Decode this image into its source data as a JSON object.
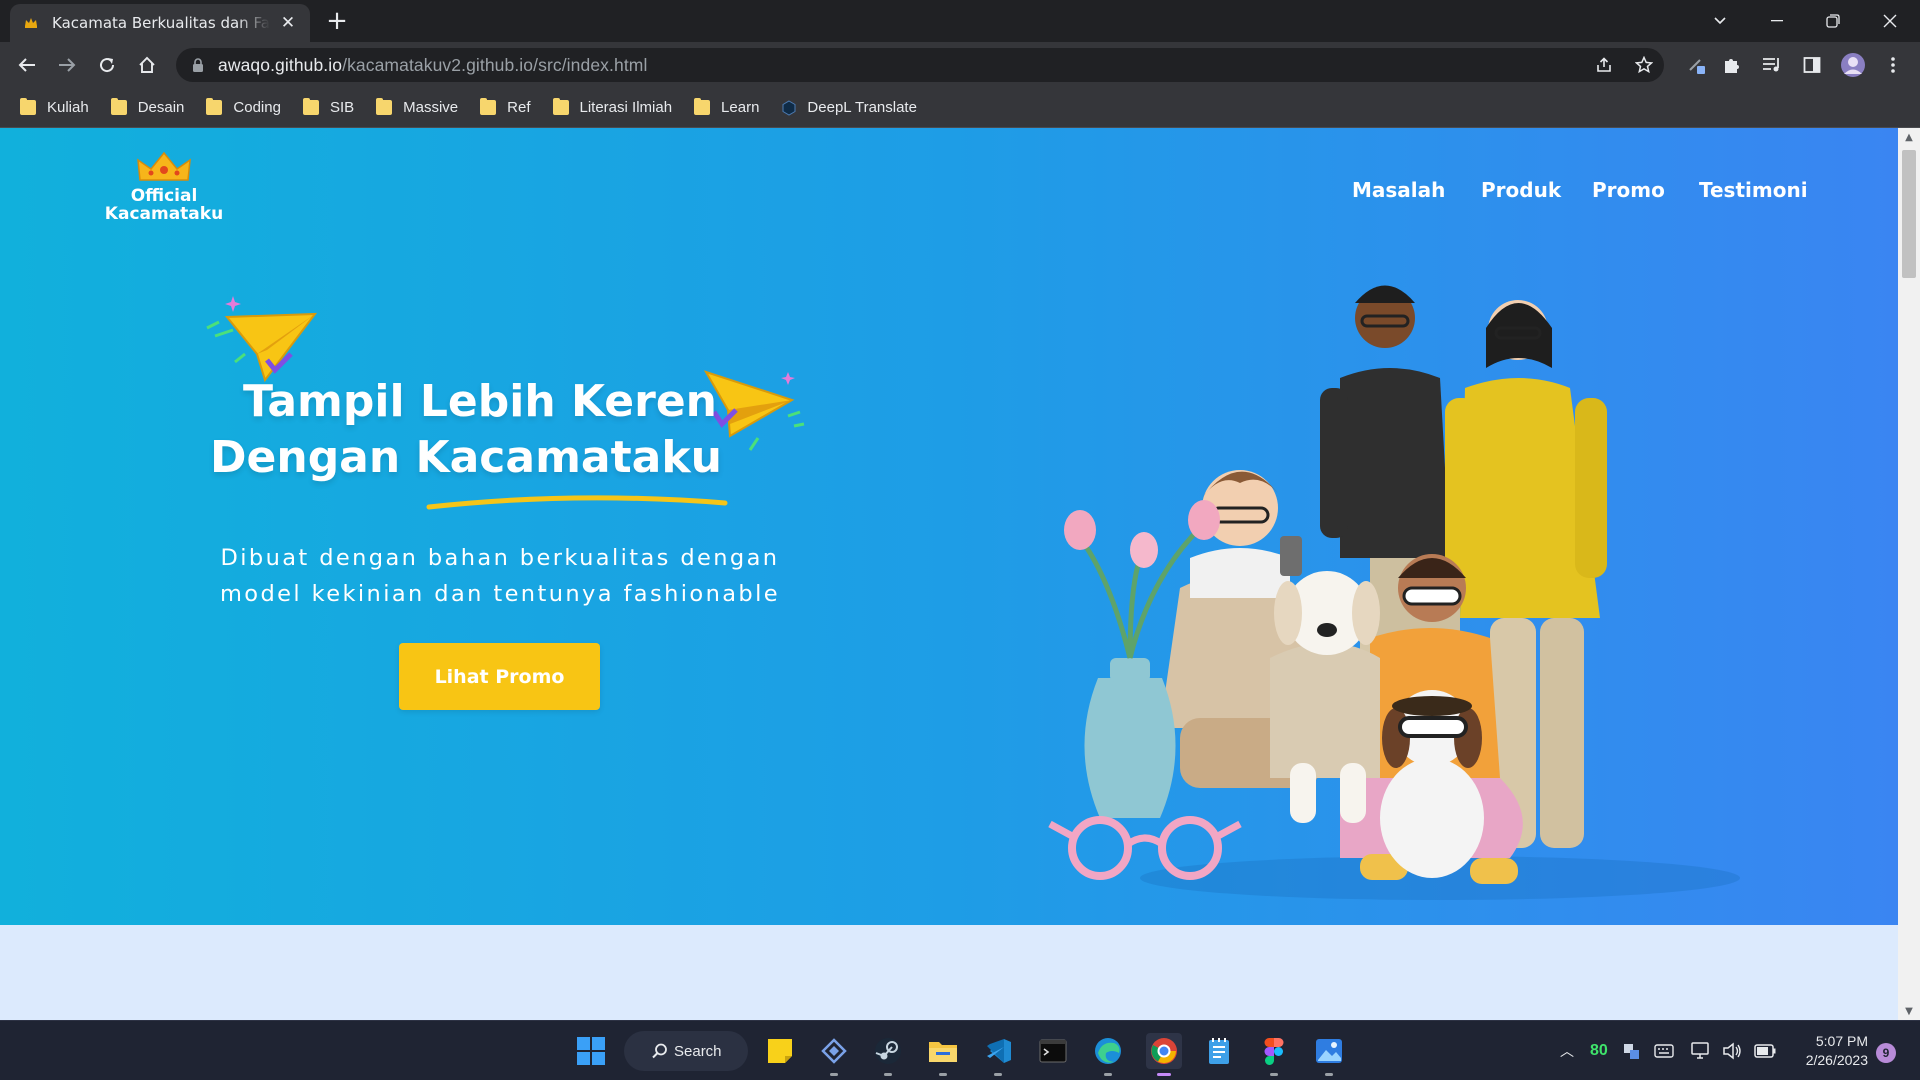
{
  "browser": {
    "tab_title": "Kacamata Berkualitas dan Fashionable",
    "new_tab_label": "+",
    "url_host": "awaqo.github.io",
    "url_path": "/kacamatakuv2.github.io/src/index.html",
    "bookmarks": [
      "Kuliah",
      "Desain",
      "Coding",
      "SIB",
      "Massive",
      "Ref",
      "Literasi Ilmiah",
      "Learn",
      "DeepL Translate"
    ],
    "colors": {
      "chrome_dark": "#202124",
      "chrome_toolbar": "#35363a",
      "folder": "#f7d66d"
    }
  },
  "page": {
    "logo_line1": "Official",
    "logo_line2": "Kacamataku",
    "nav": [
      "Masalah",
      "Produk",
      "Promo",
      "Testimoni"
    ],
    "headline_line1": "Tampil Lebih Keren",
    "headline_line2": "Dengan Kacamataku",
    "subtitle_line1": "Dibuat dengan bahan berkualitas dengan",
    "subtitle_line2": "model kekinian dan tentunya fashionable",
    "cta_label": "Lihat Promo",
    "colors": {
      "hero_left": "#11b0dc",
      "hero_right": "#3a85f2",
      "cta": "#f8c514",
      "underline": "#f5c518",
      "below_fold": "#dceafd"
    }
  },
  "taskbar": {
    "search_label": "Search",
    "tray_value": "80",
    "time": "5:07 PM",
    "date": "2/26/2023",
    "notification_count": "9"
  }
}
